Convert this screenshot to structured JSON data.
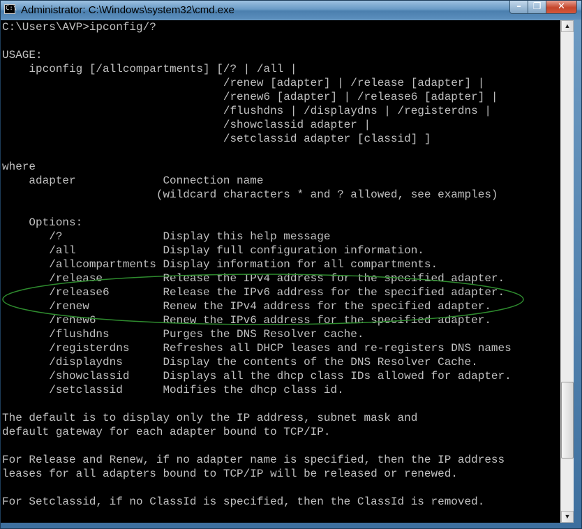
{
  "window": {
    "title": "Administrator: C:\\Windows\\system32\\cmd.exe",
    "icon_text": "C:\\"
  },
  "controls": {
    "minimize_glyph": "–",
    "maximize_glyph": "❐",
    "close_glyph": "✕"
  },
  "console": {
    "lines": [
      "C:\\Users\\AVP>ipconfig/?",
      "",
      "USAGE:",
      "    ipconfig [/allcompartments] [/? | /all |",
      "                                 /renew [adapter] | /release [adapter] |",
      "                                 /renew6 [adapter] | /release6 [adapter] |",
      "                                 /flushdns | /displaydns | /registerdns |",
      "                                 /showclassid adapter |",
      "                                 /setclassid adapter [classid] ]",
      "",
      "where",
      "    adapter             Connection name",
      "                       (wildcard characters * and ? allowed, see examples)",
      "",
      "    Options:",
      "       /?               Display this help message",
      "       /all             Display full configuration information.",
      "       /allcompartments Display information for all compartments.",
      "       /release         Release the IPv4 address for the specified adapter.",
      "       /release6        Release the IPv6 address for the specified adapter.",
      "       /renew           Renew the IPv4 address for the specified adapter.",
      "       /renew6          Renew the IPv6 address for the specified adapter.",
      "       /flushdns        Purges the DNS Resolver cache.",
      "       /registerdns     Refreshes all DHCP leases and re-registers DNS names",
      "       /displaydns      Display the contents of the DNS Resolver Cache.",
      "       /showclassid     Displays all the dhcp class IDs allowed for adapter.",
      "       /setclassid      Modifies the dhcp class id.",
      "",
      "The default is to display only the IP address, subnet mask and",
      "default gateway for each adapter bound to TCP/IP.",
      "",
      "For Release and Renew, if no adapter name is specified, then the IP address",
      "leases for all adapters bound to TCP/IP will be released or renewed.",
      "",
      "For Setclassid, if no ClassId is specified, then the ClassId is removed."
    ]
  },
  "scrollbar": {
    "up_glyph": "▲",
    "down_glyph": "▼",
    "position_fraction": 0.87
  },
  "colors": {
    "console_bg": "#000000",
    "console_fg": "#c0c0c0",
    "highlight": "#2e8b2e"
  }
}
